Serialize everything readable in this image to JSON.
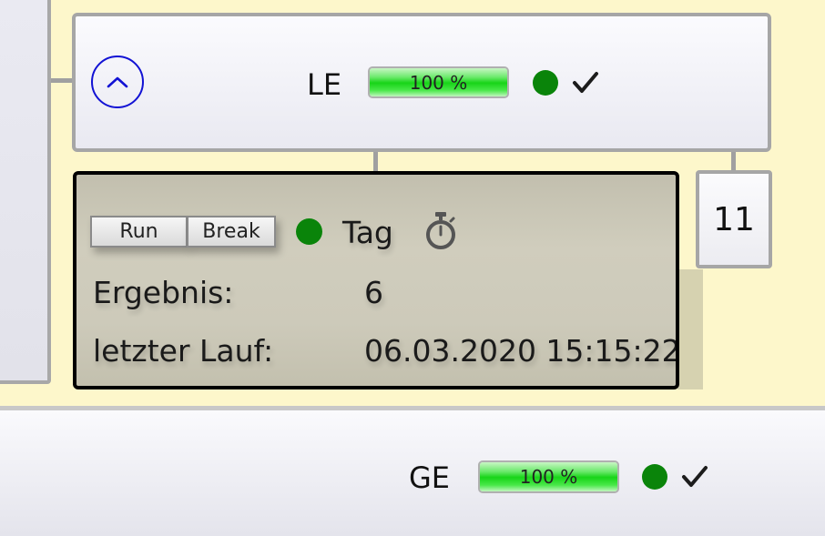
{
  "le_node": {
    "title": "LE",
    "progress": {
      "value": 100,
      "label": "100 %"
    },
    "status_color": "#0a840a",
    "check_icon": "checkmark-icon",
    "collapse_icon": "chevron-up-icon"
  },
  "detail": {
    "run_label": "Run",
    "break_label": "Break",
    "status_color": "#0a840a",
    "schedule_label": "Tag",
    "timer_icon": "stopwatch-icon",
    "result_label": "Ergebnis:",
    "result_value": "6",
    "last_run_label": "letzter Lauf:",
    "last_run_value": "06.03.2020 15:15:22"
  },
  "count_box": {
    "value": "11"
  },
  "ge_node": {
    "title": "GE",
    "progress": {
      "value": 100,
      "label": "100 %"
    },
    "status_color": "#0a840a",
    "check_icon": "checkmark-icon"
  }
}
